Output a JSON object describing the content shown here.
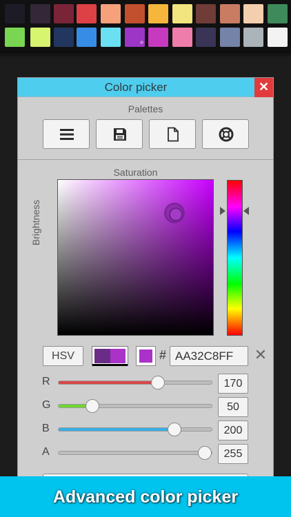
{
  "palette": {
    "swatches": [
      {
        "color": "#1d1b26"
      },
      {
        "color": "#332738"
      },
      {
        "color": "#7a2437"
      },
      {
        "color": "#de4145"
      },
      {
        "color": "#f6a07c"
      },
      {
        "color": "#c2502e"
      },
      {
        "color": "#f6b63b"
      },
      {
        "color": "#f2e47e"
      },
      {
        "color": "#703c37"
      },
      {
        "color": "#c97c62"
      },
      {
        "color": "#f4cfae"
      },
      {
        "color": "#3e8a5a"
      },
      {
        "color": "#7ad553"
      },
      {
        "color": "#d7f56e"
      },
      {
        "color": "#22375f"
      },
      {
        "color": "#378de6"
      },
      {
        "color": "#6ae0f2"
      },
      {
        "color": "#9d35c6",
        "selected": true
      },
      {
        "color": "#c63ac0"
      },
      {
        "color": "#ee7dab"
      },
      {
        "color": "#3a3556"
      },
      {
        "color": "#7483a7"
      },
      {
        "color": "#abb4b8"
      },
      {
        "color": "#f3f3f3"
      }
    ]
  },
  "dialog": {
    "title": "Color picker",
    "close_icon": "close-icon",
    "palettes_label": "Palettes",
    "palette_buttons": [
      {
        "icon": "menu-icon"
      },
      {
        "icon": "save-icon"
      },
      {
        "icon": "new-file-icon"
      },
      {
        "icon": "help-icon"
      }
    ],
    "saturation_label": "Saturation",
    "brightness_label": "Brightness",
    "mode_label": "HSV",
    "hash": "#",
    "hex_value": "AA32C8FF",
    "previous_color": "#6a2c86",
    "current_color": "#aa32c8",
    "channels": [
      {
        "label": "R",
        "value": "170",
        "fraction": 0.667,
        "color": "#d94848"
      },
      {
        "label": "G",
        "value": "50",
        "fraction": 0.196,
        "color": "#6ed630"
      },
      {
        "label": "B",
        "value": "200",
        "fraction": 0.784,
        "color": "#3aaee6"
      },
      {
        "label": "A",
        "value": "255",
        "fraction": 1.0,
        "color": "#bdbdbd"
      }
    ]
  },
  "banner": {
    "text": "Advanced color picker"
  }
}
